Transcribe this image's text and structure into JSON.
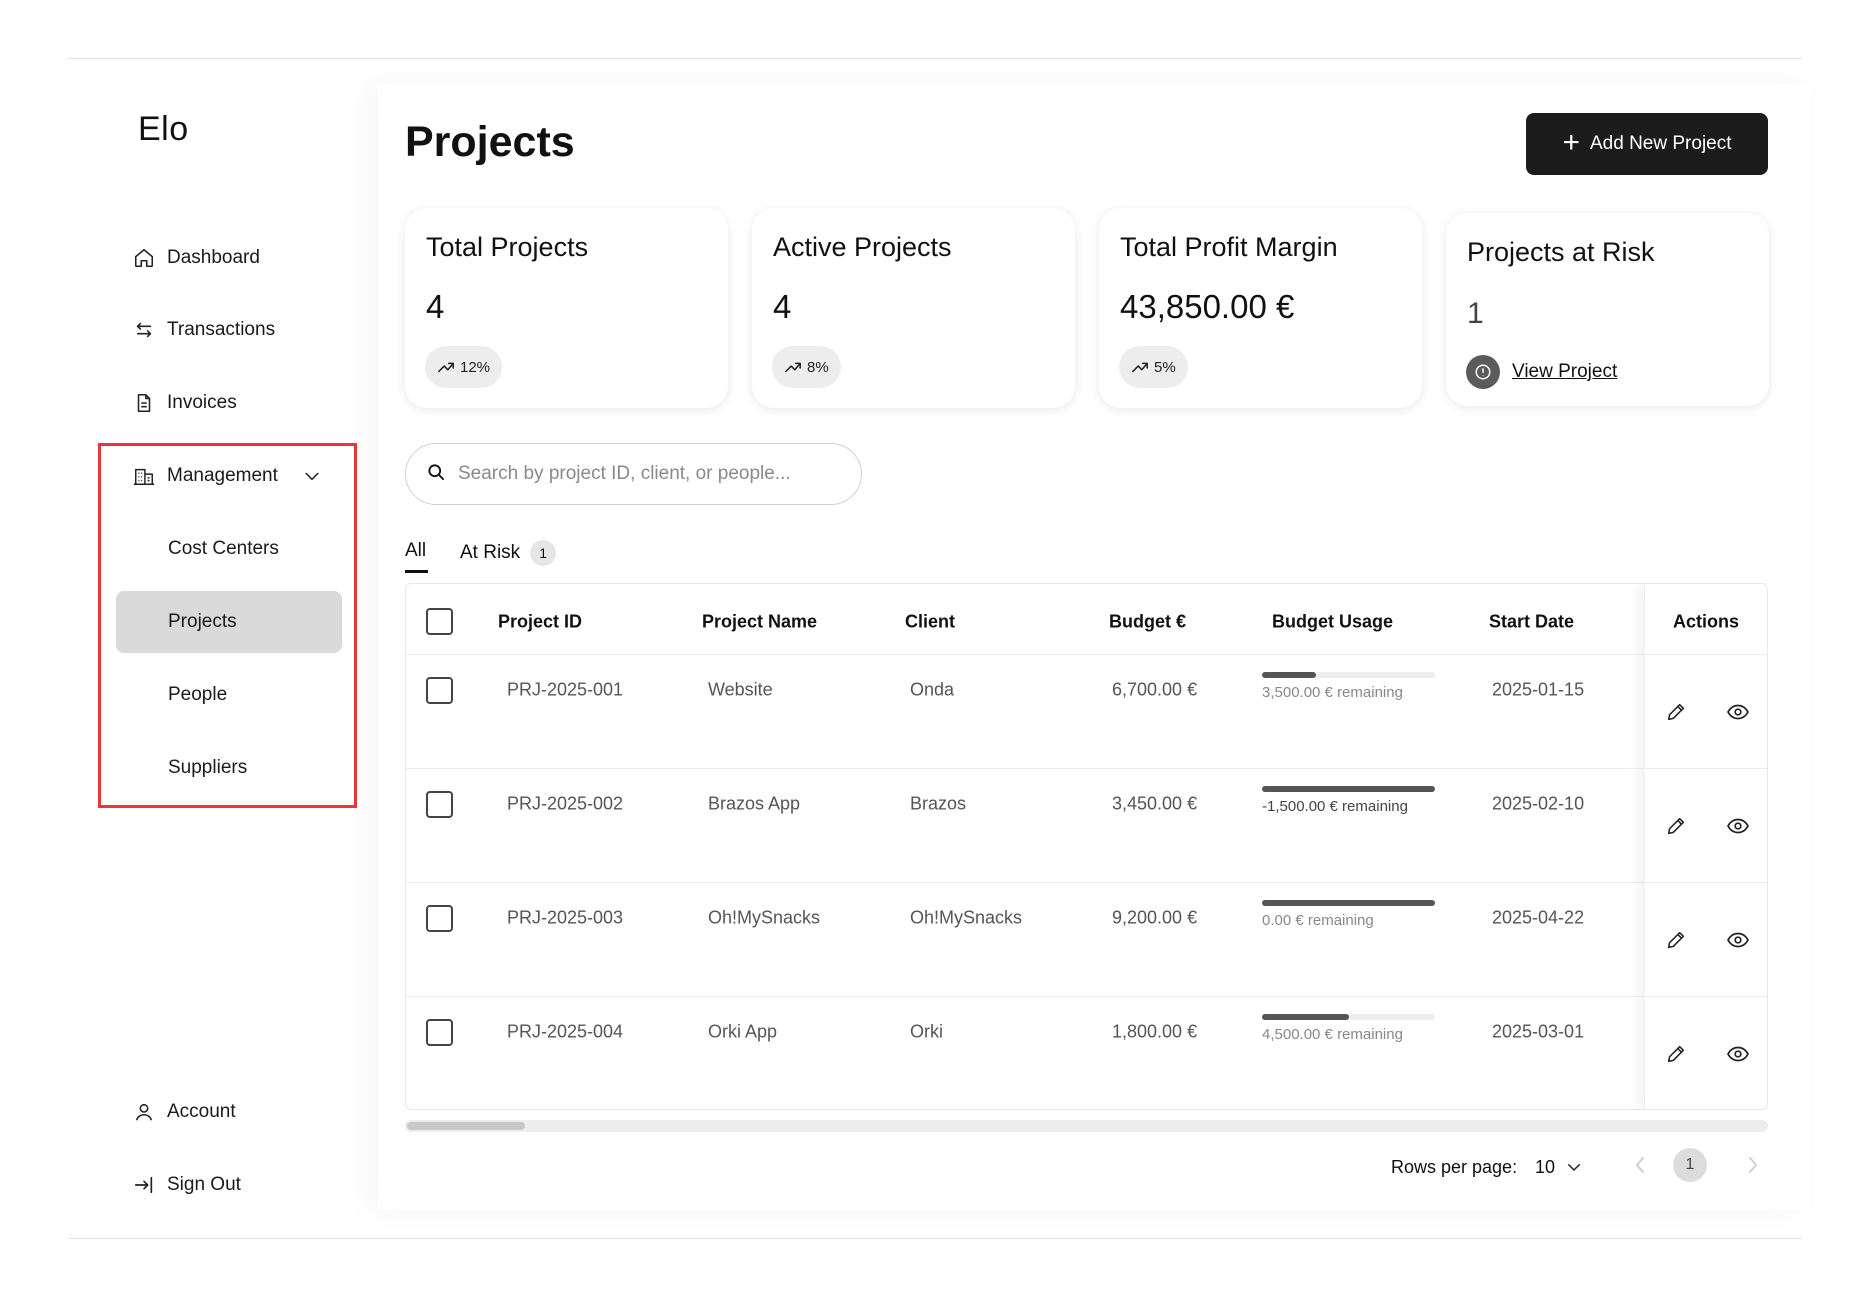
{
  "app": {
    "logo": "Elo"
  },
  "sidebar": {
    "items": [
      {
        "label": "Dashboard",
        "icon": "home-icon"
      },
      {
        "label": "Transactions",
        "icon": "arrows-swap-icon"
      },
      {
        "label": "Invoices",
        "icon": "document-icon"
      },
      {
        "label": "Management",
        "icon": "building-icon",
        "expanded": true
      }
    ],
    "subitems": [
      {
        "label": "Cost Centers"
      },
      {
        "label": "Projects",
        "active": true
      },
      {
        "label": "People"
      },
      {
        "label": "Suppliers"
      }
    ],
    "footer": [
      {
        "label": "Account",
        "icon": "user-icon"
      },
      {
        "label": "Sign Out",
        "icon": "sign-out-icon"
      }
    ]
  },
  "header": {
    "title": "Projects",
    "add_button": "Add New Project"
  },
  "stats": [
    {
      "title": "Total Projects",
      "value": "4",
      "trend": "12%"
    },
    {
      "title": "Active Projects",
      "value": "4",
      "trend": "8%"
    },
    {
      "title": "Total Profit Margin",
      "value": "43,850.00 €",
      "trend": "5%"
    },
    {
      "title": "Projects at Risk",
      "value": "1",
      "link": "View Project"
    }
  ],
  "search": {
    "placeholder": "Search by project ID, client, or people..."
  },
  "tabs": [
    {
      "label": "All",
      "active": true
    },
    {
      "label": "At Risk",
      "count": "1"
    }
  ],
  "table": {
    "columns": [
      "Project ID",
      "Project Name",
      "Client",
      "Budget €",
      "Budget Usage",
      "Start Date",
      "Actions"
    ],
    "rows": [
      {
        "id": "PRJ-2025-001",
        "name": "Website",
        "client": "Onda",
        "budget": "6,700.00 €",
        "usage_fraction": 0.31,
        "remaining": "3,500.00 € remaining",
        "start": "2025-01-15"
      },
      {
        "id": "PRJ-2025-002",
        "name": "Brazos App",
        "client": "Brazos",
        "budget": "3,450.00 €",
        "usage_fraction": 1.0,
        "remaining": "-1,500.00 € remaining",
        "start": "2025-02-10"
      },
      {
        "id": "PRJ-2025-003",
        "name": "Oh!MySnacks",
        "client": "Oh!MySnacks",
        "budget": "9,200.00 €",
        "usage_fraction": 1.0,
        "remaining": "0.00 € remaining",
        "start": "2025-04-22"
      },
      {
        "id": "PRJ-2025-004",
        "name": "Orki App",
        "client": "Orki",
        "budget": "1,800.00 €",
        "usage_fraction": 0.5,
        "remaining": "4,500.00 € remaining",
        "start": "2025-03-01"
      }
    ]
  },
  "pagination": {
    "rows_label": "Rows per page:",
    "rows_value": "10",
    "page": "1"
  },
  "colors": {
    "accent": "#1c1c1c",
    "highlight": "#e5383b",
    "active_bg": "#dadada"
  }
}
